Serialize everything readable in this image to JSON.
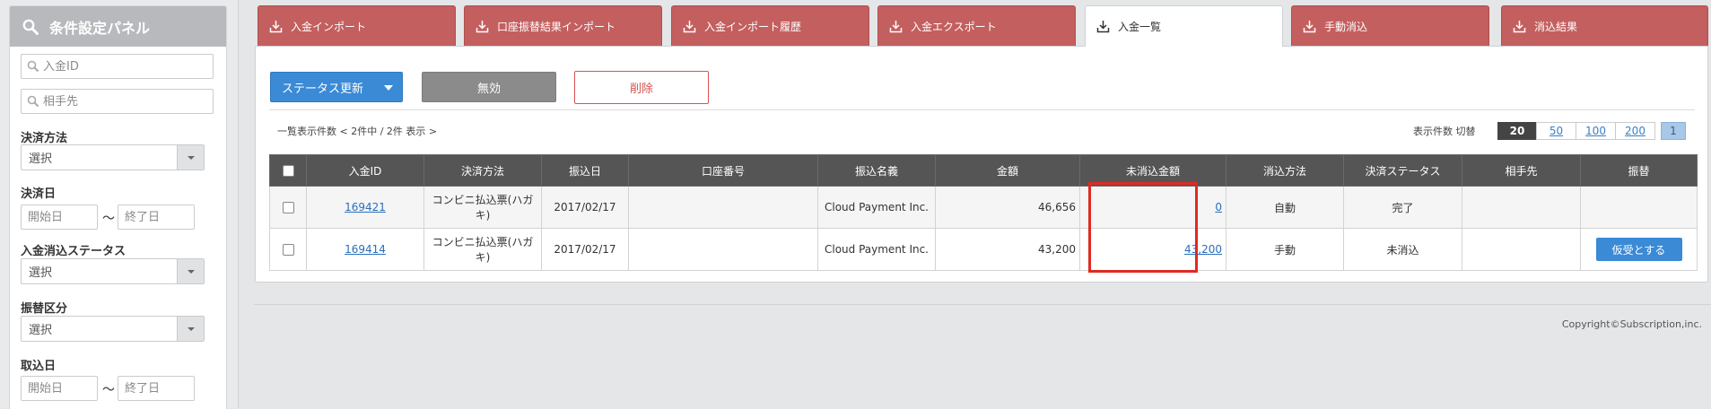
{
  "sidebar": {
    "title": "条件設定パネル",
    "payment_id_placeholder": "入金ID",
    "partner_placeholder": "相手先",
    "settle_method_label": "決済方法",
    "settle_method_value": "選択",
    "settle_date_label": "決済日",
    "date_start_placeholder": "開始日",
    "date_end_placeholder": "終了日",
    "date_sep": "〜",
    "clear_status_label": "入金消込ステータス",
    "clear_status_value": "選択",
    "transfer_label": "振替区分",
    "transfer_value": "選択",
    "import_date_label": "取込日",
    "import_start_placeholder": "開始日",
    "import_end_placeholder": "終了日"
  },
  "tabs": [
    {
      "label": "入金インポート",
      "active": false
    },
    {
      "label": "口座振替結果インポート",
      "active": false
    },
    {
      "label": "入金インポート履歴",
      "active": false
    },
    {
      "label": "入金エクスポート",
      "active": false
    },
    {
      "label": "入金一覧",
      "active": true
    },
    {
      "label": "手動消込",
      "active": false
    },
    {
      "label": "消込結果",
      "active": false
    }
  ],
  "toolbar": {
    "status_update": "ステータス更新",
    "disable": "無効",
    "delete": "削除"
  },
  "list": {
    "count_text": "一覧表示件数 < 2件中 / 2件 表示 >",
    "perpage_label": "表示件数 切替",
    "perpage_options": [
      "20",
      "50",
      "100",
      "200"
    ],
    "current_page": "1"
  },
  "table": {
    "headers": [
      "入金ID",
      "決済方法",
      "振込日",
      "口座番号",
      "振込名義",
      "金額",
      "未消込金額",
      "消込方法",
      "決済ステータス",
      "相手先",
      "振替"
    ],
    "rows": [
      {
        "id": "169421",
        "method": "コンビニ払込票(ハガキ)",
        "date": "2017/02/17",
        "account": "",
        "name": "Cloud Payment Inc.",
        "amount": "46,656",
        "uncleared": "0",
        "clear_method": "自動",
        "status": "完了",
        "partner": "",
        "action": ""
      },
      {
        "id": "169414",
        "method": "コンビニ払込票(ハガキ)",
        "date": "2017/02/17",
        "account": "",
        "name": "Cloud Payment Inc.",
        "amount": "43,200",
        "uncleared": "43,200",
        "clear_method": "手動",
        "status": "未消込",
        "partner": "",
        "action": "仮受とする"
      }
    ]
  },
  "footer": {
    "copyright": "Copyright©Subscription,inc."
  },
  "colors": {
    "tab": "#c45f5f",
    "primary": "#3a8ad6",
    "highlight": "#e02a20"
  }
}
